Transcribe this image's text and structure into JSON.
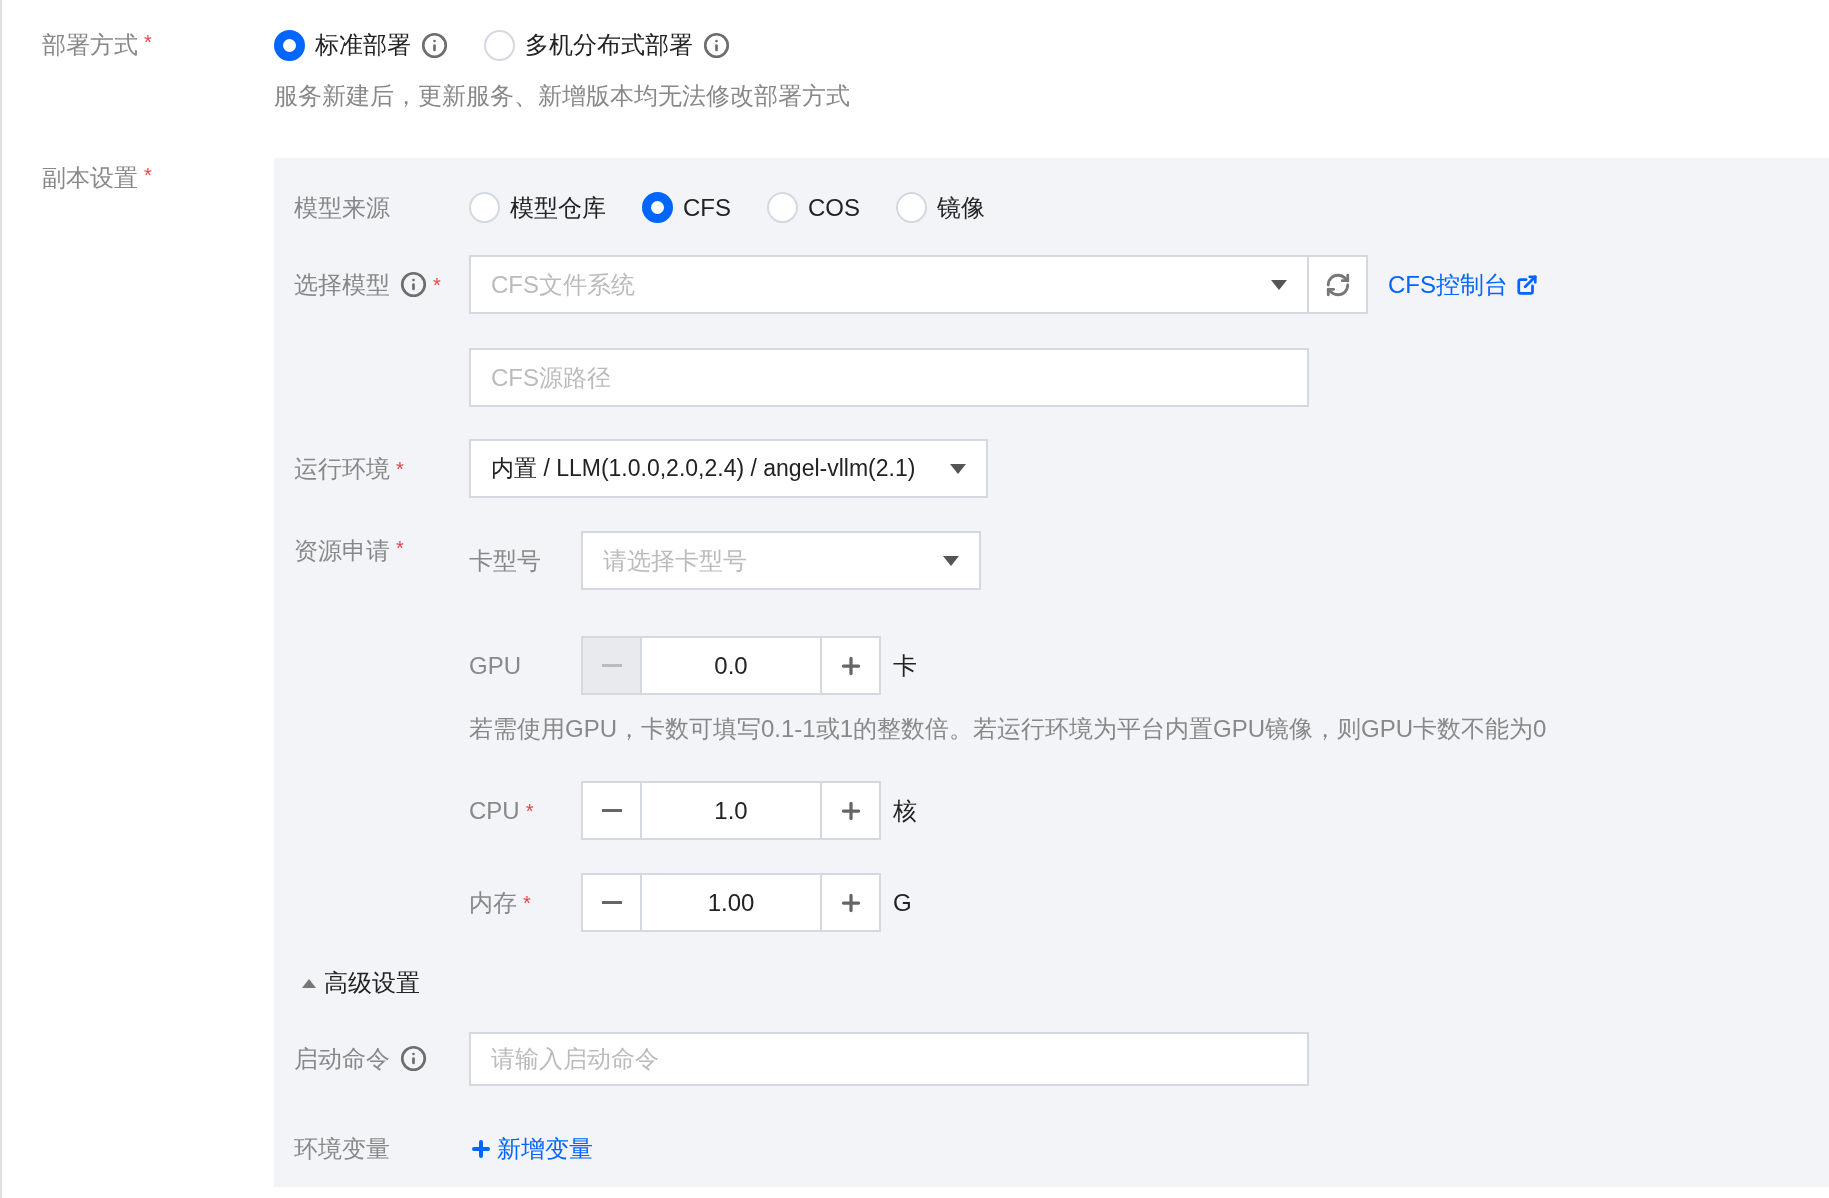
{
  "deploy_mode": {
    "label": "部署方式",
    "required_mark": "*",
    "options": [
      {
        "label": "标准部署",
        "selected": true
      },
      {
        "label": "多机分布式部署",
        "selected": false
      }
    ],
    "hint": "服务新建后，更新服务、新增版本均无法修改部署方式"
  },
  "replica_settings": {
    "label": "副本设置",
    "required_mark": "*",
    "model_source": {
      "label": "模型来源",
      "options": [
        {
          "label": "模型仓库",
          "selected": false
        },
        {
          "label": "CFS",
          "selected": true
        },
        {
          "label": "COS",
          "selected": false
        },
        {
          "label": "镜像",
          "selected": false
        }
      ]
    },
    "select_model": {
      "label": "选择模型",
      "required_mark": "*",
      "dropdown_placeholder": "CFS文件系统",
      "link": "CFS控制台",
      "path_placeholder": "CFS源路径"
    },
    "runtime": {
      "label": "运行环境",
      "required_mark": "*",
      "value": "内置 / LLM(1.0.0,2.0,2.4) / angel-vllm(2.1)"
    },
    "resources": {
      "label": "资源申请",
      "required_mark": "*",
      "card_type": {
        "label": "卡型号",
        "placeholder": "请选择卡型号"
      },
      "steppers": [
        {
          "label": "GPU",
          "value": "0.0",
          "unit": "卡",
          "minus_disabled": true,
          "hint": "若需使用GPU，卡数可填写0.1-1或1的整数倍。若运行环境为平台内置GPU镜像，则GPU卡数不能为0"
        },
        {
          "label": "CPU",
          "required_mark": "*",
          "value": "1.0",
          "unit": "核",
          "minus_disabled": false
        },
        {
          "label": "内存",
          "required_mark": "*",
          "value": "1.00",
          "unit": "G",
          "minus_disabled": false
        }
      ]
    },
    "advanced": {
      "label": "高级设置",
      "expanded": true,
      "start_command": {
        "label": "启动命令",
        "placeholder": "请输入启动命令"
      },
      "env_vars": {
        "label": "环境变量",
        "add_link": "新增变量"
      }
    }
  }
}
